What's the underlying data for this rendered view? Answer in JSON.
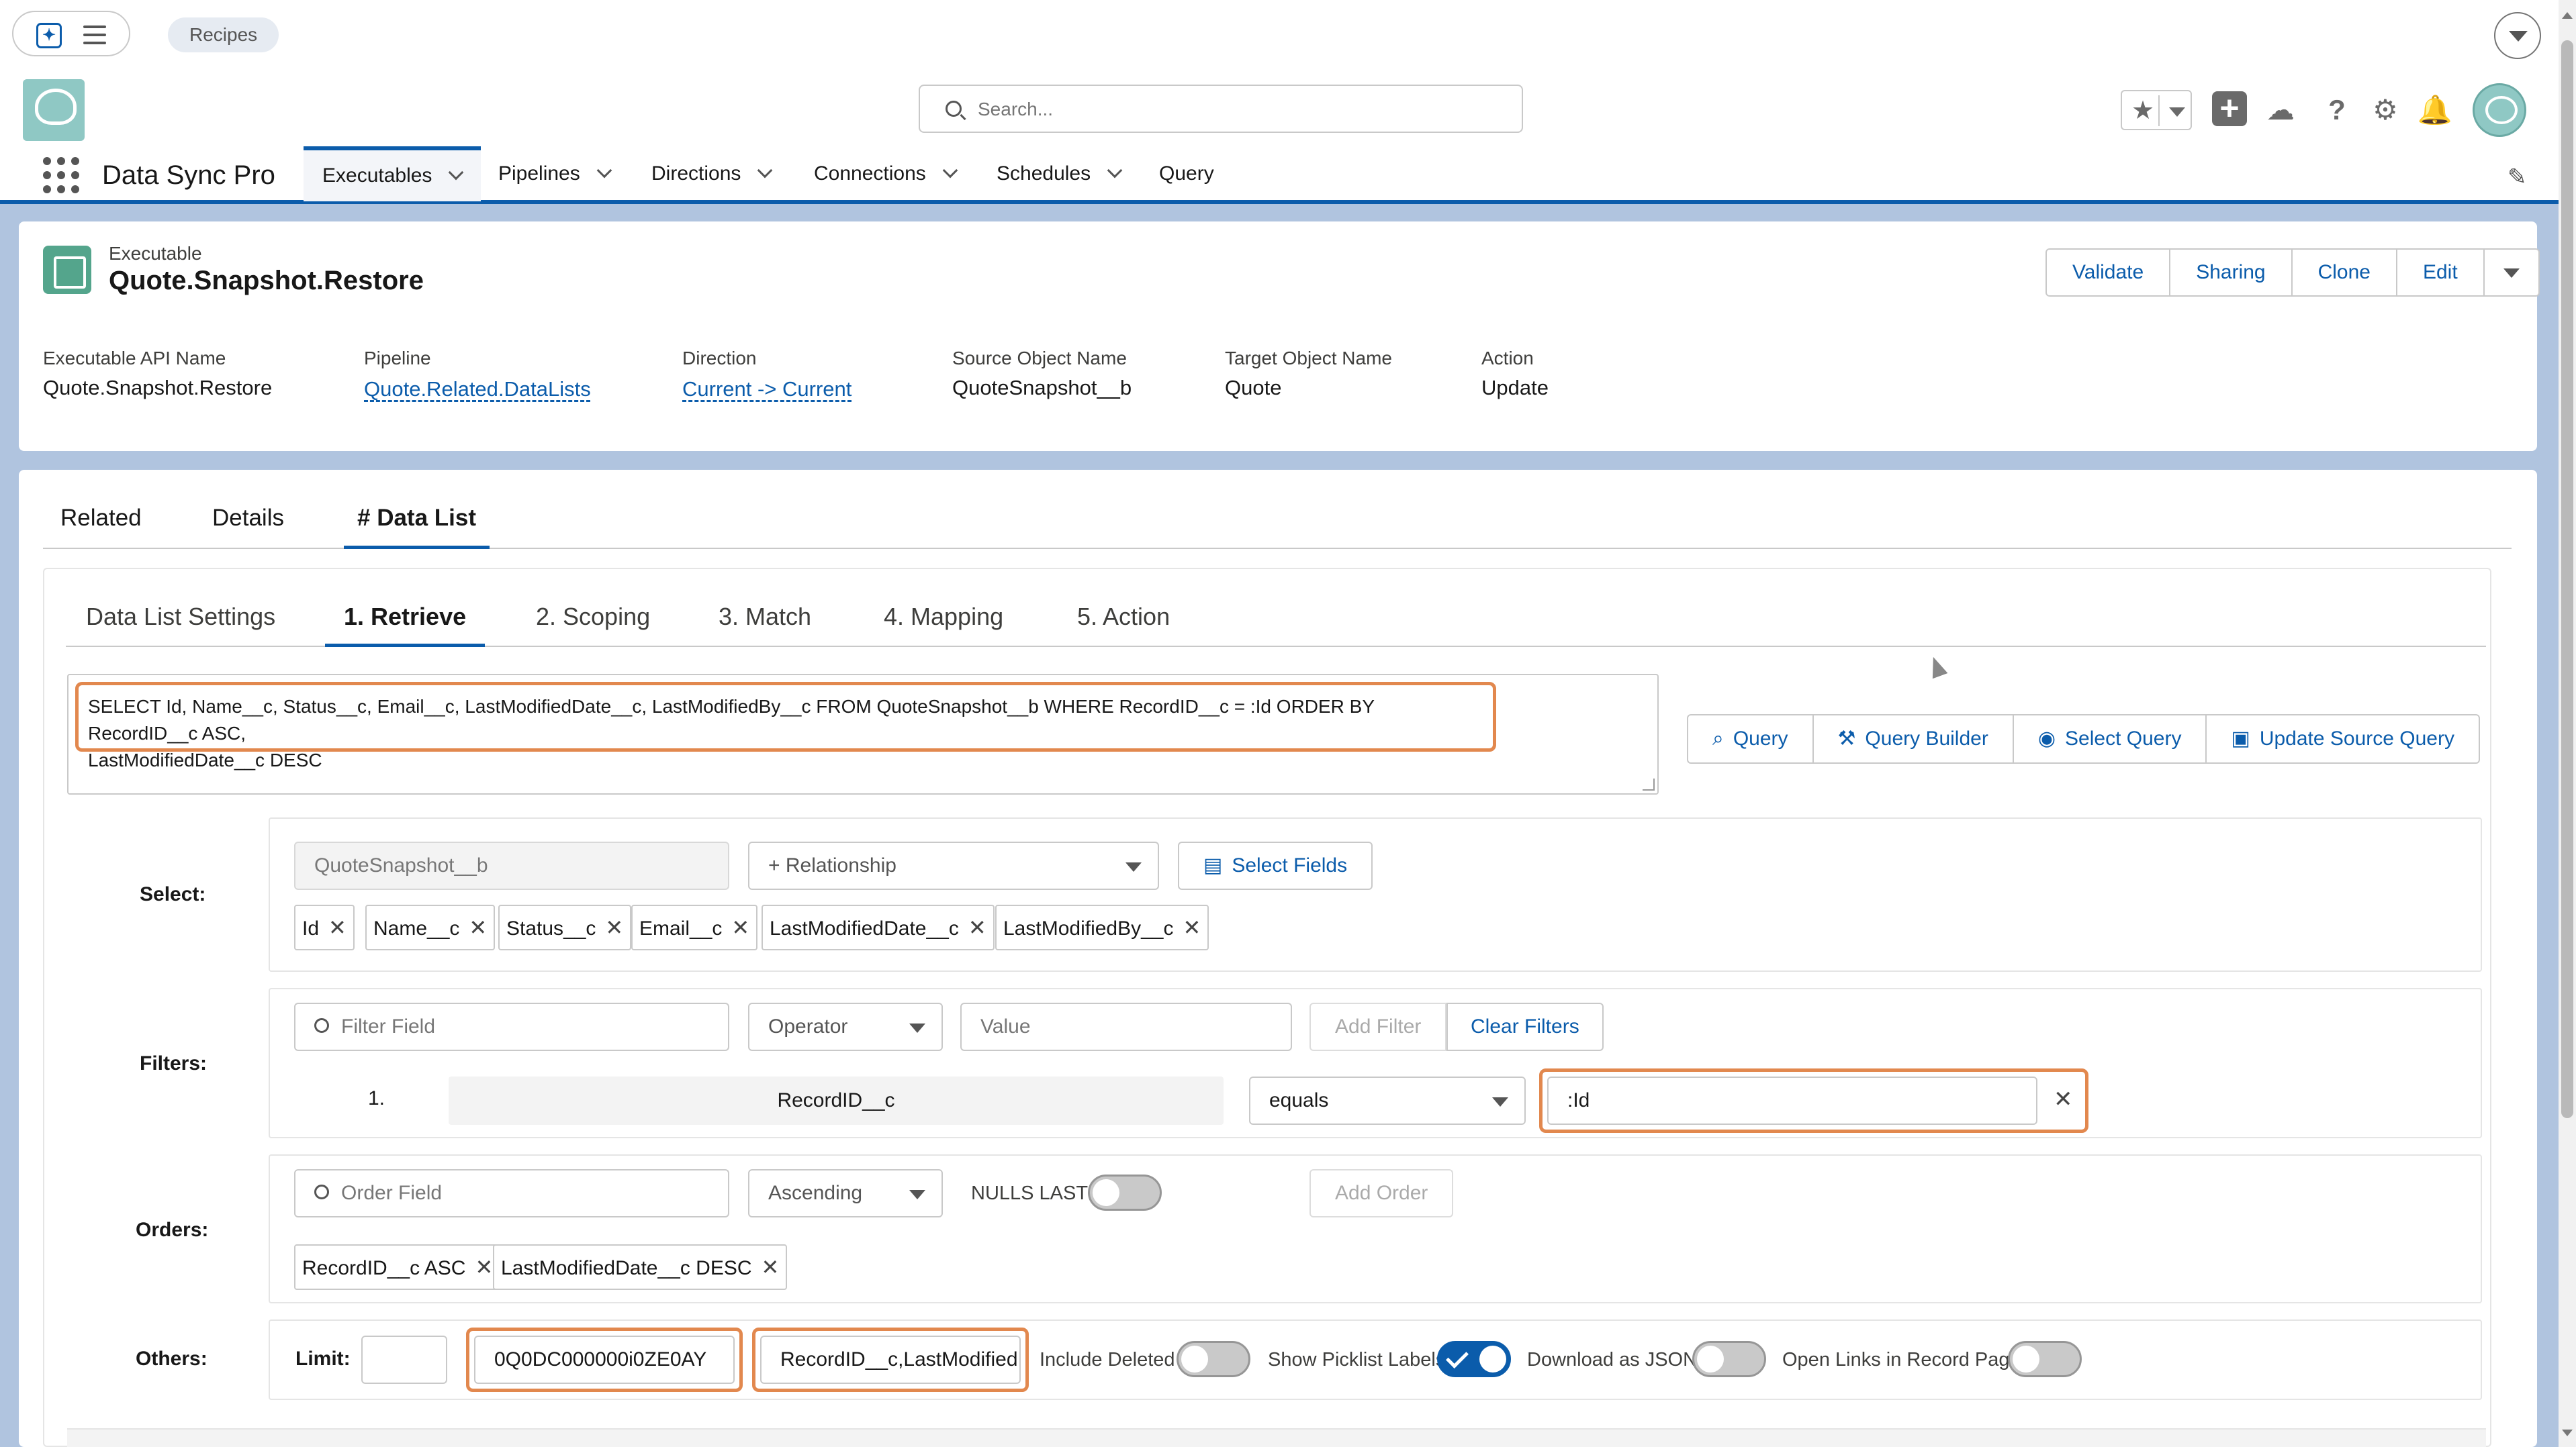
{
  "topbar": {
    "recipes_label": "Recipes"
  },
  "header": {
    "search_placeholder": "Search..."
  },
  "nav": {
    "app_name": "Data Sync Pro",
    "items": [
      {
        "label": "Executables",
        "active": true,
        "has_dropdown": true
      },
      {
        "label": "Pipelines",
        "has_dropdown": true
      },
      {
        "label": "Directions",
        "has_dropdown": true
      },
      {
        "label": "Connections",
        "has_dropdown": true
      },
      {
        "label": "Schedules",
        "has_dropdown": true
      },
      {
        "label": "Query",
        "has_dropdown": false
      }
    ]
  },
  "record": {
    "type_label": "Executable",
    "title": "Quote.Snapshot.Restore",
    "actions": [
      "Validate",
      "Sharing",
      "Clone",
      "Edit"
    ],
    "fields": [
      {
        "label": "Executable API Name",
        "value": "Quote.Snapshot.Restore",
        "link": false
      },
      {
        "label": "Pipeline",
        "value": "Quote.Related.DataLists",
        "link": true
      },
      {
        "label": "Direction",
        "value": "Current -> Current",
        "link": true
      },
      {
        "label": "Source Object Name",
        "value": "QuoteSnapshot__b",
        "link": false
      },
      {
        "label": "Target Object Name",
        "value": "Quote",
        "link": false
      },
      {
        "label": "Action",
        "value": "Update",
        "link": false
      }
    ]
  },
  "record_tabs": [
    {
      "label": "Related"
    },
    {
      "label": "Details"
    },
    {
      "label": "# Data List",
      "active": true
    }
  ],
  "datalist_tabs": [
    {
      "label": "Data List Settings"
    },
    {
      "label": "1. Retrieve",
      "active": true
    },
    {
      "label": "2. Scoping"
    },
    {
      "label": "3. Match"
    },
    {
      "label": "4. Mapping"
    },
    {
      "label": "5. Action"
    }
  ],
  "query": {
    "text_line1": "SELECT Id, Name__c, Status__c, Email__c, LastModifiedDate__c, LastModifiedBy__c FROM QuoteSnapshot__b WHERE RecordID__c = :Id ORDER BY RecordID__c ASC,",
    "text_line2": "LastModifiedDate__c DESC",
    "buttons": [
      "Query",
      "Query Builder",
      "Select Query",
      "Update Source Query"
    ]
  },
  "select_row": {
    "label": "Select:",
    "object": "QuoteSnapshot__b",
    "relationship_placeholder": "+ Relationship",
    "select_fields_label": "Select Fields",
    "fields": [
      "Id",
      "Name__c",
      "Status__c",
      "Email__c",
      "LastModifiedDate__c",
      "LastModifiedBy__c"
    ]
  },
  "filters_row": {
    "label": "Filters:",
    "field_placeholder": "Filter Field",
    "operator_placeholder": "Operator",
    "value_placeholder": "Value",
    "add_filter_label": "Add Filter",
    "clear_filters_label": "Clear Filters",
    "filter1": {
      "index": "1.",
      "field": "RecordID__c",
      "operator": "equals",
      "value": ":Id"
    }
  },
  "orders_row": {
    "label": "Orders:",
    "field_placeholder": "Order Field",
    "direction": "Ascending",
    "nulls_last_label": "NULLS LAST?",
    "nulls_last": false,
    "add_order_label": "Add Order",
    "orders": [
      "RecordID__c ASC",
      "LastModifiedDate__c DESC"
    ]
  },
  "others_row": {
    "label": "Others:",
    "limit_label": "Limit:",
    "limit_value": "",
    "record_id_value": "0Q0DC000000i0ZE0AY",
    "fields_value": "RecordID__c,LastModifiedDa",
    "toggles": [
      {
        "label": "Include Deleted",
        "on": false
      },
      {
        "label": "Show Picklist Labels",
        "on": true
      },
      {
        "label": "Download as JSON",
        "on": false
      },
      {
        "label": "Open Links in Record Page",
        "on": false
      }
    ]
  },
  "colors": {
    "brand": "#0b5cab",
    "highlight": "#e2884e",
    "background": "#b0c4df"
  },
  "icons": [
    "app-launcher-icon",
    "menu-icon",
    "search-icon",
    "star-icon",
    "add-icon",
    "cloud-icon",
    "help-icon",
    "gear-icon",
    "bell-icon",
    "avatar",
    "edit-icon"
  ]
}
